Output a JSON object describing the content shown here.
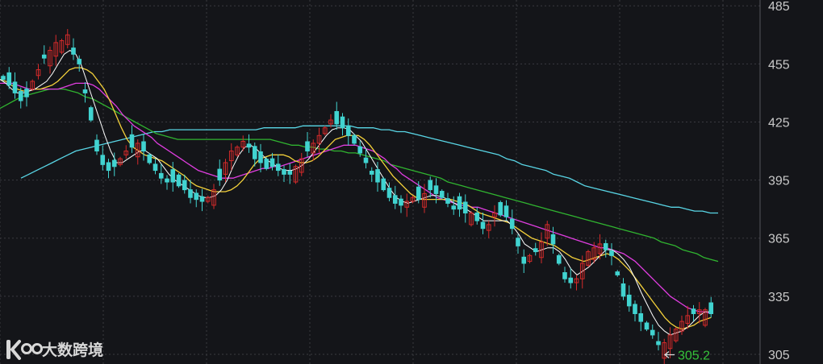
{
  "colors": {
    "background": "#141519",
    "grid": "#3a3a40",
    "rising": "#d42a2a",
    "falling": "#41d3d0",
    "ma_5": "#ffffff",
    "ma_10": "#f3d03a",
    "ma_20": "#e03de0",
    "ma_60": "#30b430",
    "ma_120": "#59d6e6",
    "low_annotation": "#35c23a"
  },
  "watermark": {
    "text": "大数跨境",
    "icon": "kdb-logo-icon"
  },
  "chart_data": {
    "type": "candlestick",
    "title": "",
    "xlabel": "",
    "ylabel": "",
    "ylim": [
      300,
      488
    ],
    "y_ticks": [
      "485",
      "455",
      "425",
      "395",
      "365",
      "335",
      "305"
    ],
    "y_tick_values": [
      485,
      455,
      425,
      395,
      365,
      335,
      305
    ],
    "grid": true,
    "low_annotation": {
      "label": "305.2",
      "value": 305.2,
      "index": 112
    },
    "close": [
      447,
      444,
      440,
      436,
      438,
      446,
      452,
      458,
      462,
      466,
      467,
      470,
      460,
      455,
      440,
      426,
      410,
      403,
      400,
      402,
      406,
      410,
      412,
      414,
      410,
      404,
      400,
      396,
      394,
      394,
      392,
      390,
      386,
      385,
      384,
      386,
      390,
      395,
      404,
      410,
      412,
      415,
      412,
      406,
      404,
      401,
      402,
      400,
      398,
      398,
      402,
      406,
      410,
      414,
      418,
      422,
      426,
      424,
      422,
      418,
      414,
      409,
      404,
      398,
      394,
      390,
      386,
      383,
      382,
      384,
      386,
      385,
      388,
      390,
      388,
      386,
      383,
      380,
      380,
      378,
      378,
      374,
      370,
      372,
      378,
      377,
      376,
      370,
      361,
      352,
      356,
      358,
      363,
      372,
      362,
      352,
      344,
      342,
      344,
      352,
      358,
      360,
      362,
      359,
      356,
      346,
      335,
      330,
      326,
      322,
      318,
      315,
      310,
      311,
      315,
      318,
      322,
      325,
      326,
      328,
      328,
      326
    ],
    "ma_5": [
      447,
      445,
      442,
      440,
      440,
      441,
      442,
      444,
      446,
      450,
      455,
      460,
      462,
      460,
      454,
      445,
      436,
      427,
      418,
      410,
      404,
      404,
      406,
      408,
      410,
      410,
      408,
      406,
      402,
      398,
      395,
      393,
      391,
      389,
      387,
      386,
      386,
      387,
      390,
      395,
      402,
      408,
      412,
      413,
      411,
      408,
      405,
      403,
      401,
      400,
      400,
      401,
      403,
      406,
      410,
      414,
      418,
      421,
      422,
      422,
      421,
      418,
      415,
      410,
      405,
      400,
      395,
      390,
      386,
      384,
      383,
      384,
      385,
      386,
      387,
      387,
      386,
      385,
      383,
      381,
      380,
      378,
      376,
      374,
      374,
      374,
      374,
      374,
      371,
      367,
      362,
      360,
      358,
      359,
      360,
      360,
      358,
      354,
      349,
      346,
      348,
      350,
      353,
      356,
      359,
      359,
      357,
      354,
      350,
      344,
      337,
      331,
      325,
      320,
      317,
      315,
      316,
      317,
      319,
      322,
      325,
      327,
      327
    ],
    "ma_10": [
      447,
      446,
      444,
      442,
      441,
      441,
      442,
      442,
      443,
      444,
      446,
      449,
      452,
      453,
      453,
      452,
      450,
      446,
      442,
      436,
      429,
      422,
      416,
      412,
      410,
      408,
      407,
      406,
      405,
      403,
      401,
      399,
      397,
      394,
      392,
      391,
      390,
      389,
      389,
      389,
      390,
      392,
      395,
      399,
      403,
      406,
      407,
      408,
      408,
      408,
      407,
      405,
      404,
      404,
      405,
      407,
      410,
      413,
      416,
      417,
      418,
      418,
      418,
      416,
      413,
      409,
      405,
      401,
      397,
      394,
      391,
      388,
      386,
      385,
      385,
      385,
      385,
      385,
      385,
      384,
      383,
      382,
      380,
      378,
      377,
      376,
      375,
      374,
      373,
      371,
      369,
      367,
      365,
      364,
      363,
      362,
      361,
      359,
      357,
      355,
      354,
      353,
      354,
      355,
      356,
      357,
      356,
      354,
      351,
      348,
      344,
      340,
      336,
      332,
      328,
      324,
      321,
      319,
      318,
      319,
      320,
      322,
      323,
      324
    ],
    "ma_20": [
      445,
      445,
      445,
      444,
      443,
      442,
      442,
      442,
      442,
      442,
      442,
      443,
      444,
      445,
      445,
      445,
      444,
      442,
      439,
      436,
      433,
      429,
      426,
      423,
      421,
      419,
      417,
      414,
      412,
      410,
      408,
      406,
      404,
      402,
      400,
      399,
      398,
      397,
      396,
      396,
      396,
      397,
      398,
      399,
      400,
      401,
      401,
      402,
      402,
      403,
      404,
      405,
      406,
      407,
      408,
      409,
      410,
      411,
      412,
      413,
      413,
      413,
      412,
      411,
      410,
      408,
      406,
      403,
      401,
      398,
      396,
      394,
      392,
      390,
      388,
      386,
      385,
      384,
      383,
      382,
      382,
      381,
      381,
      380,
      379,
      378,
      377,
      376,
      375,
      374,
      373,
      372,
      371,
      370,
      369,
      368,
      367,
      366,
      365,
      364,
      363,
      362,
      361,
      360,
      360,
      359,
      358,
      357,
      355,
      353,
      350,
      347,
      344,
      341,
      338,
      335,
      333,
      331,
      329,
      328,
      327,
      327,
      326
    ],
    "ma_60": [
      432,
      434,
      436,
      438,
      439,
      440,
      441,
      442,
      442,
      442,
      441,
      440,
      438,
      437,
      435,
      433,
      431,
      429,
      427,
      425,
      423,
      421,
      419,
      418,
      417,
      416,
      416,
      416,
      416,
      416,
      416,
      416,
      416,
      416,
      416,
      416,
      416,
      416,
      416,
      415,
      414,
      413,
      413,
      412,
      412,
      411,
      411,
      410,
      410,
      409,
      409,
      408,
      407,
      406,
      405,
      403,
      402,
      401,
      400,
      399,
      398,
      397,
      396,
      394,
      393,
      392,
      391,
      390,
      389,
      388,
      387,
      386,
      385,
      384,
      383,
      382,
      381,
      380,
      379,
      378,
      377,
      376,
      375,
      374,
      373,
      372,
      371,
      370,
      369,
      368,
      367,
      366,
      365,
      363,
      362,
      361,
      359,
      358,
      357,
      355,
      354,
      353
    ],
    "ma_120": [
      396,
      398,
      400,
      402,
      404,
      406,
      408,
      410,
      411,
      412,
      413,
      414,
      415,
      416,
      417,
      418,
      419,
      420,
      420,
      421,
      421,
      421,
      421,
      421,
      421,
      421,
      421,
      421,
      421,
      421,
      421,
      422,
      422,
      422,
      422,
      422,
      423,
      423,
      423,
      423,
      423,
      423,
      423,
      422,
      422,
      422,
      421,
      421,
      420,
      420,
      419,
      418,
      417,
      416,
      415,
      414,
      413,
      412,
      411,
      410,
      409,
      408,
      406,
      405,
      403,
      402,
      401,
      400,
      398,
      397,
      396,
      394,
      392,
      391,
      390,
      389,
      388,
      387,
      386,
      385,
      384,
      383,
      382,
      381,
      381,
      380,
      379,
      379,
      378,
      378
    ]
  }
}
